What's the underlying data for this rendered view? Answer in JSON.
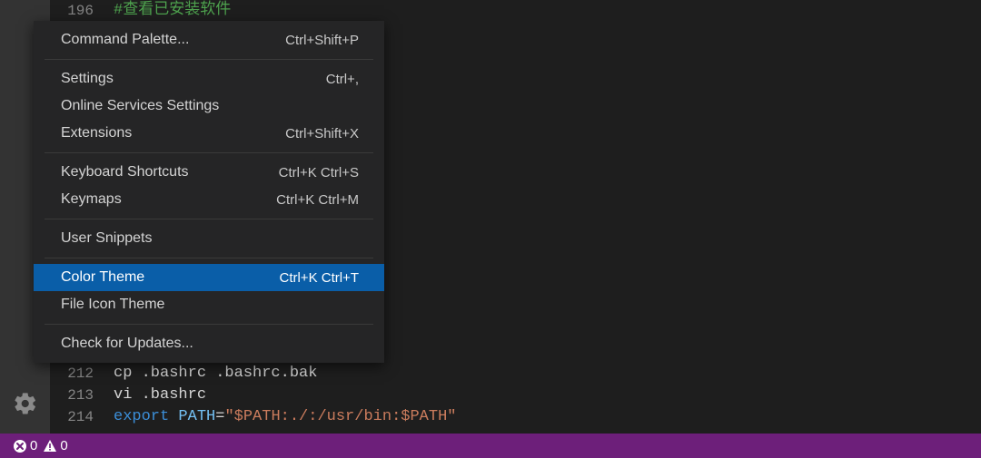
{
  "editor": {
    "top_line": {
      "num": "196",
      "text": "#查看已安装软件"
    },
    "bottom_lines": [
      {
        "num": "212",
        "tokens": [
          {
            "cls": "c-default",
            "text": "cp .bashrc .bashrc.bak"
          }
        ]
      },
      {
        "num": "213",
        "tokens": [
          {
            "cls": "c-default",
            "text": "vi .bashrc"
          }
        ]
      },
      {
        "num": "214",
        "tokens": [
          {
            "cls": "c-keyword",
            "text": "export"
          },
          {
            "cls": "c-default",
            "text": " "
          },
          {
            "cls": "c-ident",
            "text": "PATH"
          },
          {
            "cls": "c-default",
            "text": "="
          },
          {
            "cls": "c-string",
            "text": "\"$PATH:./:/usr/bin:$PATH\""
          }
        ]
      }
    ]
  },
  "menu": {
    "items": [
      {
        "label": "Command Palette...",
        "shortcut": "Ctrl+Shift+P",
        "selected": false,
        "sep_after": true
      },
      {
        "label": "Settings",
        "shortcut": "Ctrl+,",
        "selected": false,
        "sep_after": false
      },
      {
        "label": "Online Services Settings",
        "shortcut": "",
        "selected": false,
        "sep_after": false
      },
      {
        "label": "Extensions",
        "shortcut": "Ctrl+Shift+X",
        "selected": false,
        "sep_after": true
      },
      {
        "label": "Keyboard Shortcuts",
        "shortcut": "Ctrl+K Ctrl+S",
        "selected": false,
        "sep_after": false
      },
      {
        "label": "Keymaps",
        "shortcut": "Ctrl+K Ctrl+M",
        "selected": false,
        "sep_after": true
      },
      {
        "label": "User Snippets",
        "shortcut": "",
        "selected": false,
        "sep_after": true
      },
      {
        "label": "Color Theme",
        "shortcut": "Ctrl+K Ctrl+T",
        "selected": true,
        "sep_after": false
      },
      {
        "label": "File Icon Theme",
        "shortcut": "",
        "selected": false,
        "sep_after": true
      },
      {
        "label": "Check for Updates...",
        "shortcut": "",
        "selected": false,
        "sep_after": false
      }
    ]
  },
  "status": {
    "errors": "0",
    "warnings": "0"
  },
  "colors": {
    "status_bg": "#6d1f7a",
    "menu_selected_bg": "#0a5ea8"
  }
}
